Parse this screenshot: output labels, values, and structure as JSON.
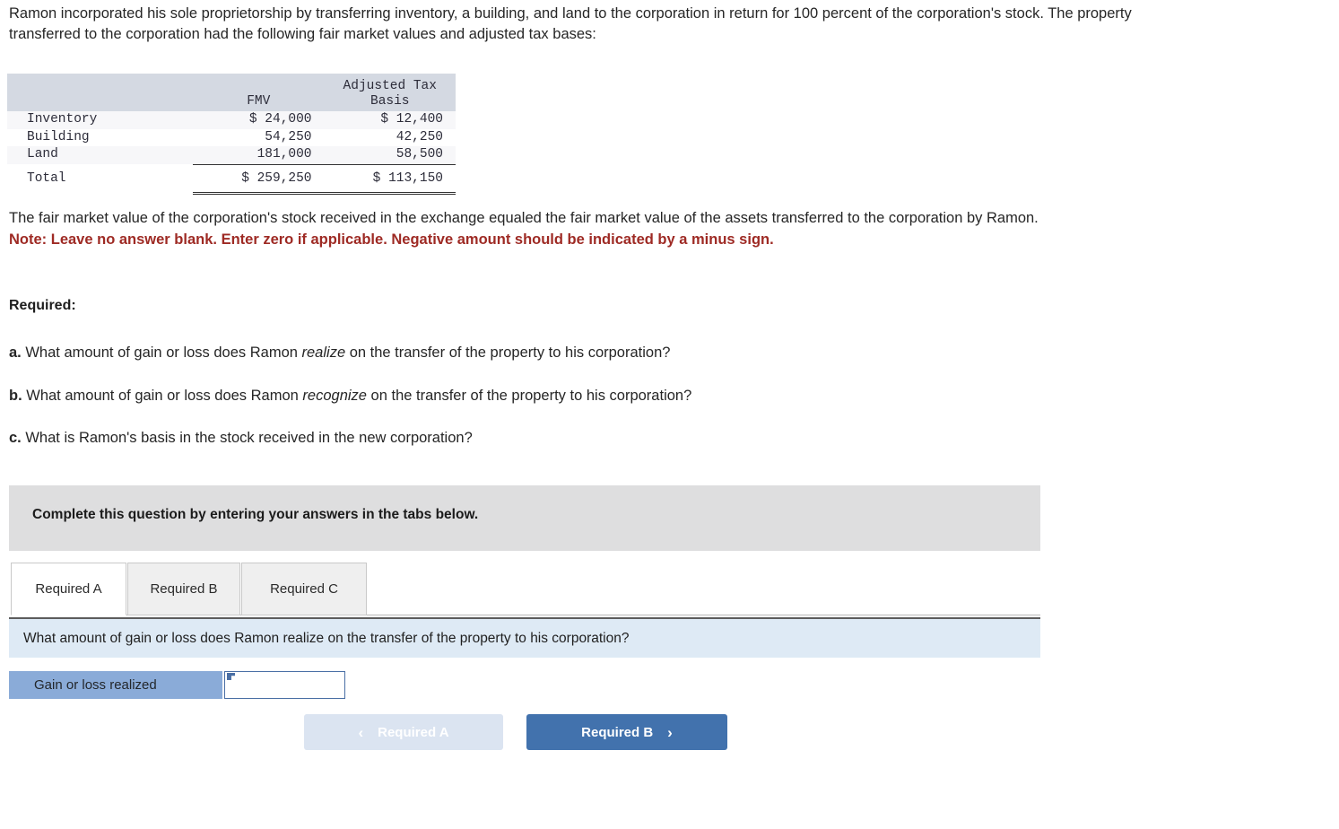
{
  "intro": {
    "paragraph": "Ramon incorporated his sole proprietorship by transferring inventory, a building, and land to the corporation in return for 100 percent of the corporation's stock. The property transferred to the corporation had the following fair market values and adjusted tax bases:"
  },
  "fin_table": {
    "columns": [
      "",
      "FMV",
      "Adjusted Tax Basis"
    ],
    "col_header_fmv": "FMV",
    "col_header_basis_line1": "Adjusted Tax",
    "col_header_basis_line2": "Basis",
    "rows": [
      {
        "label": "Inventory",
        "fmv": "$ 24,000",
        "basis": "$ 12,400"
      },
      {
        "label": "Building",
        "fmv": "54,250",
        "basis": "42,250"
      },
      {
        "label": "Land",
        "fmv": "181,000",
        "basis": "58,500"
      }
    ],
    "total": {
      "label": "Total",
      "fmv": "$ 259,250",
      "basis": "$ 113,150"
    }
  },
  "mid_prose": {
    "fmv_statement": "The fair market value of the corporation's stock received in the exchange equaled the fair market value of the assets transferred to the corporation by Ramon.",
    "note": "Note: Leave no answer blank. Enter zero if applicable. Negative amount should be indicated by a minus sign.",
    "required_heading": "Required:"
  },
  "questions": [
    {
      "bullet": "a.",
      "pre": " What amount of gain or loss does Ramon ",
      "em": "realize",
      "post": " on the transfer of the property to his corporation?"
    },
    {
      "bullet": "b.",
      "pre": " What amount of gain or loss does Ramon ",
      "em": "recognize",
      "post": " on the transfer of the property to his corporation?"
    },
    {
      "bullet": "c.",
      "pre": " What is Ramon's basis in the stock received in the new corporation?",
      "em": "",
      "post": ""
    }
  ],
  "banner": {
    "text": "Complete this question by entering your answers in the tabs below."
  },
  "tabs": [
    {
      "label": "Required A",
      "active": true
    },
    {
      "label": "Required B",
      "active": false
    },
    {
      "label": "Required C",
      "active": false
    }
  ],
  "question_bar": {
    "text": "What amount of gain or loss does Ramon realize on the transfer of the property to his corporation?"
  },
  "answer": {
    "label": "Gain or loss realized",
    "value": "",
    "placeholder": ""
  },
  "nav": {
    "prev_label": "Required A",
    "prev_icon": "chevron-left-icon",
    "prev_glyph": "‹",
    "prev_disabled": true,
    "next_label": "Required B",
    "next_icon": "chevron-right-icon",
    "next_glyph": "›"
  },
  "colors": {
    "table_header_bg": "#d4d9e2",
    "table_stripe": "#f7f7f9",
    "banner_bg": "#dededf",
    "question_bar_bg": "#deeaf5",
    "answer_label_bg": "#8aabd8",
    "note_red": "#9e2a24",
    "btn_active_bg": "#4272ad",
    "btn_disabled_bg": "#dbe4f1",
    "input_border": "#4a6fa5"
  }
}
